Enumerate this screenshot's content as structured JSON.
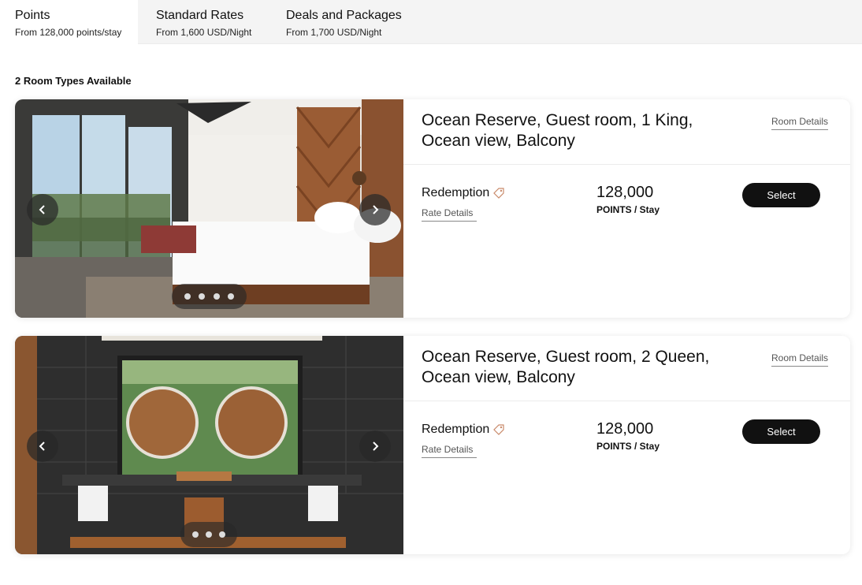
{
  "tabs": [
    {
      "title": "Points",
      "subtitle": "From 128,000 points/stay",
      "active": true
    },
    {
      "title": "Standard Rates",
      "subtitle": "From 1,600 USD/Night",
      "active": false
    },
    {
      "title": "Deals and Packages",
      "subtitle": "From 1,700 USD/Night",
      "active": false
    }
  ],
  "room_count_label": "2 Room Types Available",
  "rooms": [
    {
      "title": "Ocean Reserve, Guest room, 1 King, Ocean view, Balcony",
      "room_details_label": "Room Details",
      "rate_name": "Redemption",
      "rate_details_label": "Rate Details",
      "price": "128,000",
      "price_unit": "POINTS / Stay",
      "select_label": "Select",
      "photo_count": 4,
      "photo_icon": "bedroom-photo"
    },
    {
      "title": "Ocean Reserve, Guest room, 2 Queen, Ocean view, Balcony",
      "room_details_label": "Room Details",
      "rate_name": "Redemption",
      "rate_details_label": "Rate Details",
      "price": "128,000",
      "price_unit": "POINTS / Stay",
      "select_label": "Select",
      "photo_count": 3,
      "photo_icon": "bathroom-photo"
    }
  ],
  "colors": {
    "accent_tag": "#c98a6a",
    "button_bg": "#111111"
  }
}
